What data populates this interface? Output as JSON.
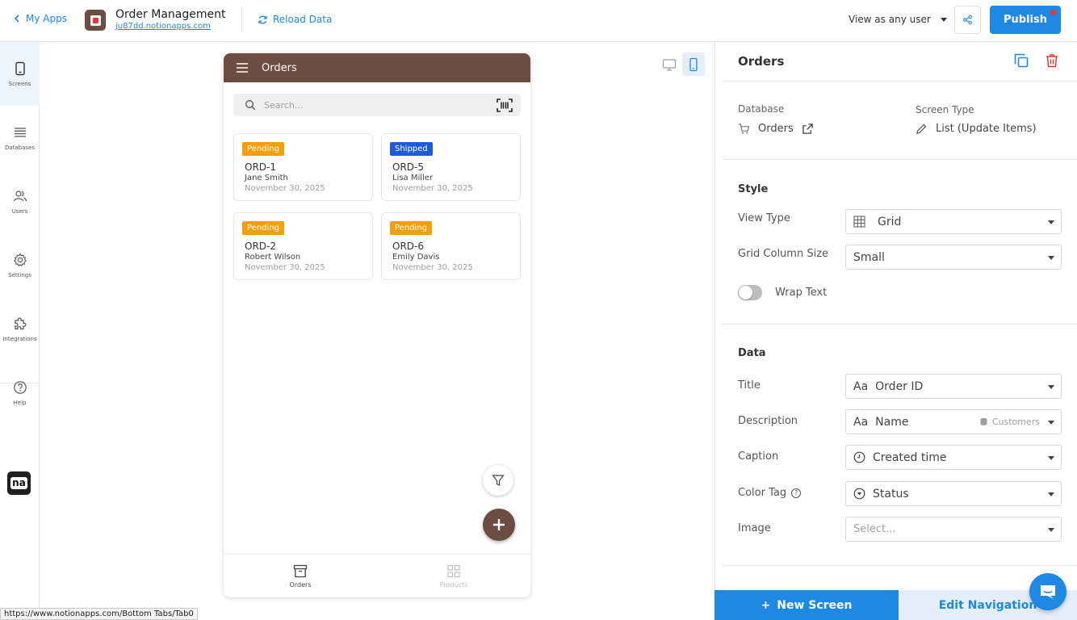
{
  "topbar": {
    "back_label": "My Apps",
    "app_title": "Order Management",
    "app_url": "ju87dd.notionapps.com",
    "reload_label": "Reload Data",
    "view_as_prefix": "View as",
    "view_as_value": "any user",
    "publish_label": "Publish"
  },
  "rail": {
    "items": [
      {
        "label": "Screens",
        "icon": "phone-icon"
      },
      {
        "label": "Databases",
        "icon": "list-icon"
      },
      {
        "label": "Users",
        "icon": "users-icon"
      },
      {
        "label": "Settings",
        "icon": "gear-icon"
      },
      {
        "label": "Integrations",
        "icon": "puzzle-icon"
      },
      {
        "label": "Help",
        "icon": "help-icon"
      }
    ],
    "logo_text": "na"
  },
  "phone": {
    "header_title": "Orders",
    "search_placeholder": "Search...",
    "cards": [
      {
        "status": "Pending",
        "status_color": "#f59e0b",
        "title": "ORD-1",
        "description": "Jane Smith",
        "caption": "November 30, 2025"
      },
      {
        "status": "Shipped",
        "status_color": "#1e5bd6",
        "title": "ORD-5",
        "description": "Lisa Miller",
        "caption": "November 30, 2025"
      },
      {
        "status": "Pending",
        "status_color": "#f59e0b",
        "title": "ORD-2",
        "description": "Robert Wilson",
        "caption": "November 30, 2025"
      },
      {
        "status": "Pending",
        "status_color": "#f59e0b",
        "title": "ORD-6",
        "description": "Emily Davis",
        "caption": "November 30, 2025"
      }
    ],
    "tabs": [
      {
        "label": "Orders",
        "active": true
      },
      {
        "label": "Products",
        "active": false
      }
    ]
  },
  "panel": {
    "title": "Orders",
    "database_label": "Database",
    "database_value": "Orders",
    "screen_type_label": "Screen Type",
    "screen_type_value": "List (Update Items)",
    "style_heading": "Style",
    "view_type_label": "View Type",
    "view_type_value": "Grid",
    "grid_column_size_label": "Grid Column Size",
    "grid_column_size_value": "Small",
    "wrap_text_label": "Wrap Text",
    "wrap_text_on": false,
    "data_heading": "Data",
    "title_label": "Title",
    "title_value": "Order ID",
    "description_label": "Description",
    "description_value": "Name",
    "description_source": "Customers",
    "caption_label": "Caption",
    "caption_value": "Created time",
    "color_tag_label": "Color Tag",
    "color_tag_value": "Status",
    "image_label": "Image",
    "image_placeholder": "Select...",
    "aa_glyph": "Aa"
  },
  "footer": {
    "new_screen_label": "New Screen",
    "edit_navigation_label": "Edit Navigation",
    "status_url": "https://www.notionapps.com/Bottom Tabs/Tab0"
  },
  "colors": {
    "accent": "#1e88e5",
    "brand": "#6d4c41",
    "pending": "#f59e0b",
    "shipped": "#1e5bd6"
  }
}
